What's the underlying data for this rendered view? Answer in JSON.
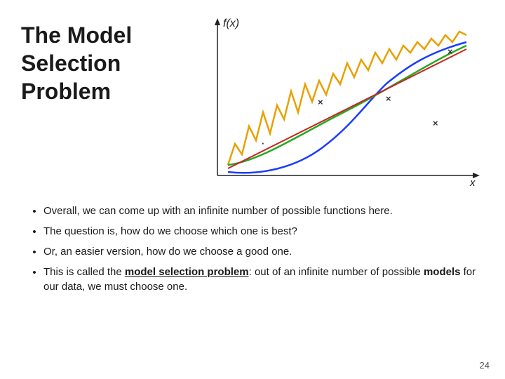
{
  "title": {
    "line1": "The Model",
    "line2": "Selection",
    "line3": "Problem"
  },
  "bullets": [
    {
      "text": "Overall, we can come up with an infinite number of possible functions here."
    },
    {
      "text": "The question is, how do we choose which one is best?"
    },
    {
      "text": "Or, an easier version, how do we choose a good one."
    },
    {
      "text_parts": [
        {
          "text": "This is called the ",
          "style": "normal"
        },
        {
          "text": "model selection problem",
          "style": "underline-bold"
        },
        {
          "text": ": out of an infinite number of possible ",
          "style": "normal"
        },
        {
          "text": "models",
          "style": "bold"
        },
        {
          "text": " for our data, we must choose one.",
          "style": "normal"
        }
      ]
    }
  ],
  "page_number": "24",
  "chart": {
    "fx_label": "f(x)",
    "x_label": "x"
  }
}
